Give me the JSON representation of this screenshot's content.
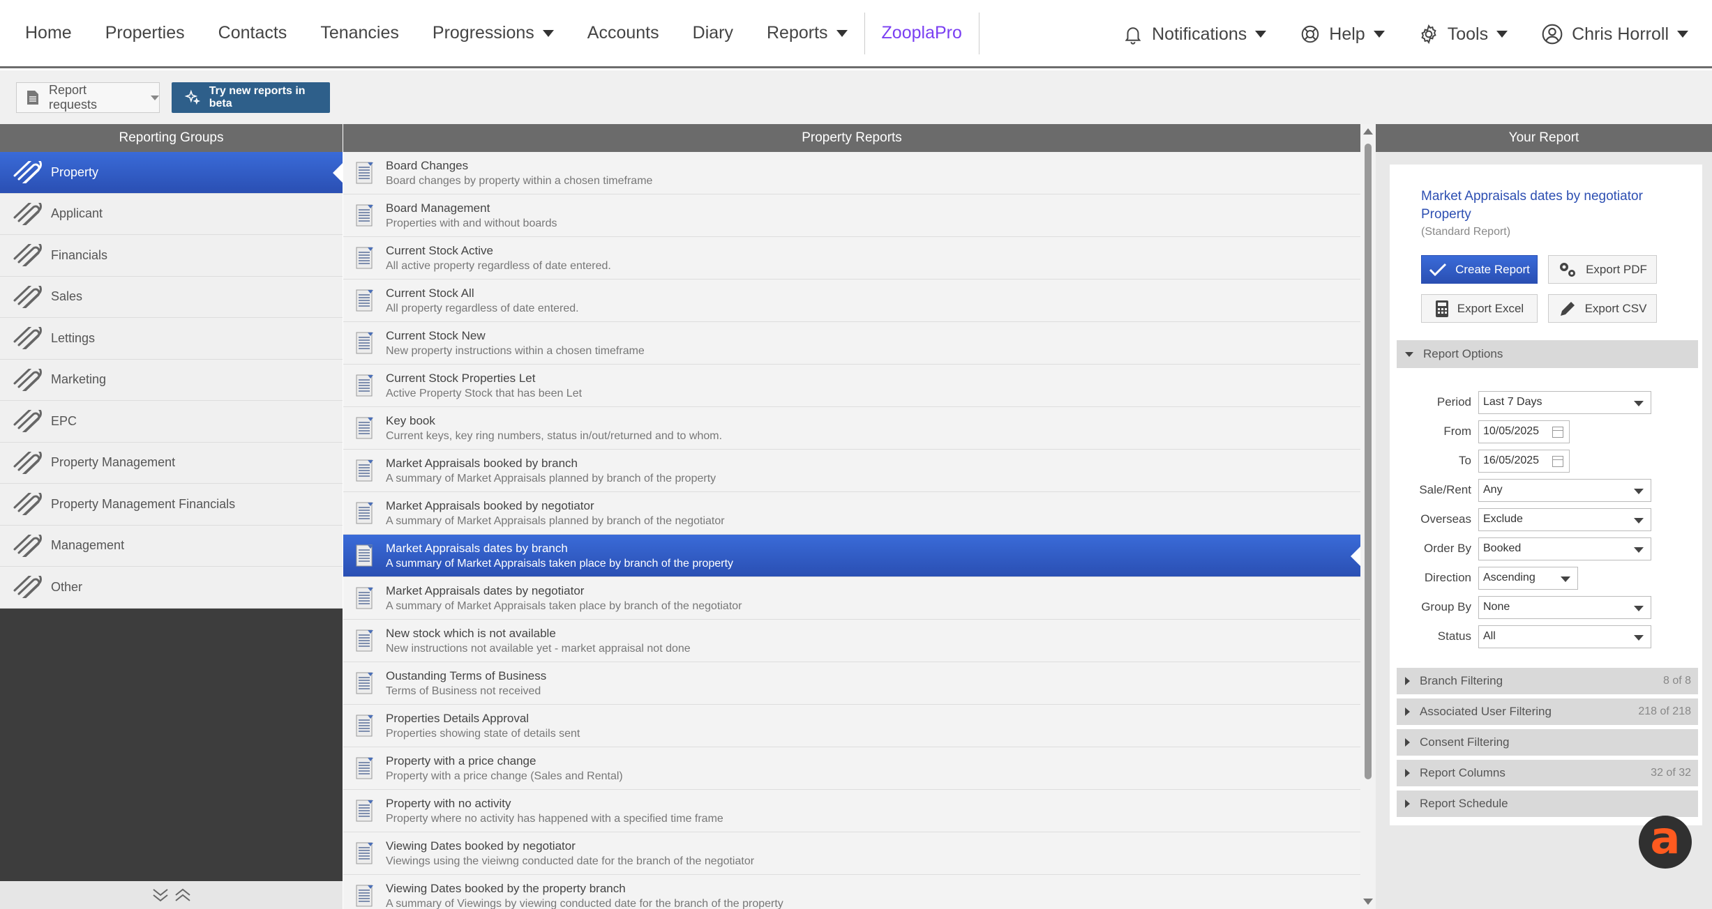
{
  "nav": {
    "items": [
      {
        "label": "Home",
        "dropdown": false
      },
      {
        "label": "Properties",
        "dropdown": false
      },
      {
        "label": "Contacts",
        "dropdown": false
      },
      {
        "label": "Tenancies",
        "dropdown": false
      },
      {
        "label": "Progressions",
        "dropdown": true
      },
      {
        "label": "Accounts",
        "dropdown": false
      },
      {
        "label": "Diary",
        "dropdown": false
      },
      {
        "label": "Reports",
        "dropdown": true
      }
    ],
    "zoopla": "ZooplaPro",
    "notifications": "Notifications",
    "help": "Help",
    "tools": "Tools",
    "user": "Chris Horroll"
  },
  "toolbar": {
    "report_requests": "Report requests",
    "beta": "Try new reports in beta"
  },
  "groups": {
    "heading": "Reporting Groups",
    "items": [
      "Property",
      "Applicant",
      "Financials",
      "Sales",
      "Lettings",
      "Marketing",
      "EPC",
      "Property Management",
      "Property Management Financials",
      "Management",
      "Other"
    ],
    "active_index": 0
  },
  "reports": {
    "heading": "Property Reports",
    "active_index": 9,
    "items": [
      {
        "title": "Board Changes",
        "desc": "Board changes by property within a chosen timeframe"
      },
      {
        "title": "Board Management",
        "desc": "Properties with and without boards"
      },
      {
        "title": "Current Stock Active",
        "desc": "All active property regardless of date entered."
      },
      {
        "title": "Current Stock All",
        "desc": "All property regardless of date entered."
      },
      {
        "title": "Current Stock New",
        "desc": "New property instructions within a chosen timeframe"
      },
      {
        "title": "Current Stock Properties Let",
        "desc": "Active Property Stock that has been Let"
      },
      {
        "title": "Key book",
        "desc": "Current keys, key ring numbers, status in/out/returned and to whom."
      },
      {
        "title": "Market Appraisals booked by branch",
        "desc": "A summary of Market Appraisals planned by branch of the property"
      },
      {
        "title": "Market Appraisals booked by negotiator",
        "desc": "A summary of Market Appraisals planned by branch of the negotiator"
      },
      {
        "title": "Market Appraisals dates by branch",
        "desc": "A summary of Market Appraisals taken place by branch of the property"
      },
      {
        "title": "Market Appraisals dates by negotiator",
        "desc": "A summary of Market Appraisals taken place by branch of the negotiator"
      },
      {
        "title": "New stock which is not available",
        "desc": "New instructions not available yet - market appraisal not done"
      },
      {
        "title": "Oustanding Terms of Business",
        "desc": "Terms of Business not received"
      },
      {
        "title": "Properties Details Approval",
        "desc": "Properties showing state of details sent"
      },
      {
        "title": "Property with a price change",
        "desc": "Property with a price change (Sales and Rental)"
      },
      {
        "title": "Property with no activity",
        "desc": "Property where no activity has happened with a specified time frame"
      },
      {
        "title": "Viewing Dates booked by negotiator",
        "desc": "Viewings using the vieiwng conducted date for the branch of the negotiator"
      },
      {
        "title": "Viewing Dates booked by the property branch",
        "desc": "A summary of Viewings by viewing conducted date for the branch of the property"
      }
    ]
  },
  "your_report": {
    "heading": "Your Report",
    "title": "Market Appraisals dates by negotiator",
    "category": "Property",
    "type": "(Standard Report)",
    "buttons": {
      "create": "Create Report",
      "pdf": "Export PDF",
      "excel": "Export Excel",
      "csv": "Export CSV"
    },
    "options_heading": "Report Options",
    "options": [
      {
        "label": "Period",
        "value": "Last 7 Days",
        "kind": "select",
        "wide": true
      },
      {
        "label": "From",
        "value": "10/05/2025",
        "kind": "date"
      },
      {
        "label": "To",
        "value": "16/05/2025",
        "kind": "date"
      },
      {
        "label": "Sale/Rent",
        "value": "Any",
        "kind": "select",
        "wide": true
      },
      {
        "label": "Overseas",
        "value": "Exclude",
        "kind": "select",
        "wide": true
      },
      {
        "label": "Order By",
        "value": "Booked",
        "kind": "select",
        "wide": true
      },
      {
        "label": "Direction",
        "value": "Ascending",
        "kind": "select",
        "wide": false
      },
      {
        "label": "Group By",
        "value": "None",
        "kind": "select",
        "wide": true
      },
      {
        "label": "Status",
        "value": "All",
        "kind": "select",
        "wide": true
      }
    ],
    "sections": [
      {
        "label": "Branch Filtering",
        "count": "8 of 8"
      },
      {
        "label": "Associated User Filtering",
        "count": "218 of 218"
      },
      {
        "label": "Consent Filtering",
        "count": ""
      },
      {
        "label": "Report Columns",
        "count": "32 of 32"
      },
      {
        "label": "Report Schedule",
        "count": ""
      }
    ]
  },
  "colors": {
    "accent": "#2d4fb2",
    "zoopla": "#7a3ff2",
    "beta_button": "#2e5f8a",
    "brand_a": "#ff5a1f"
  }
}
